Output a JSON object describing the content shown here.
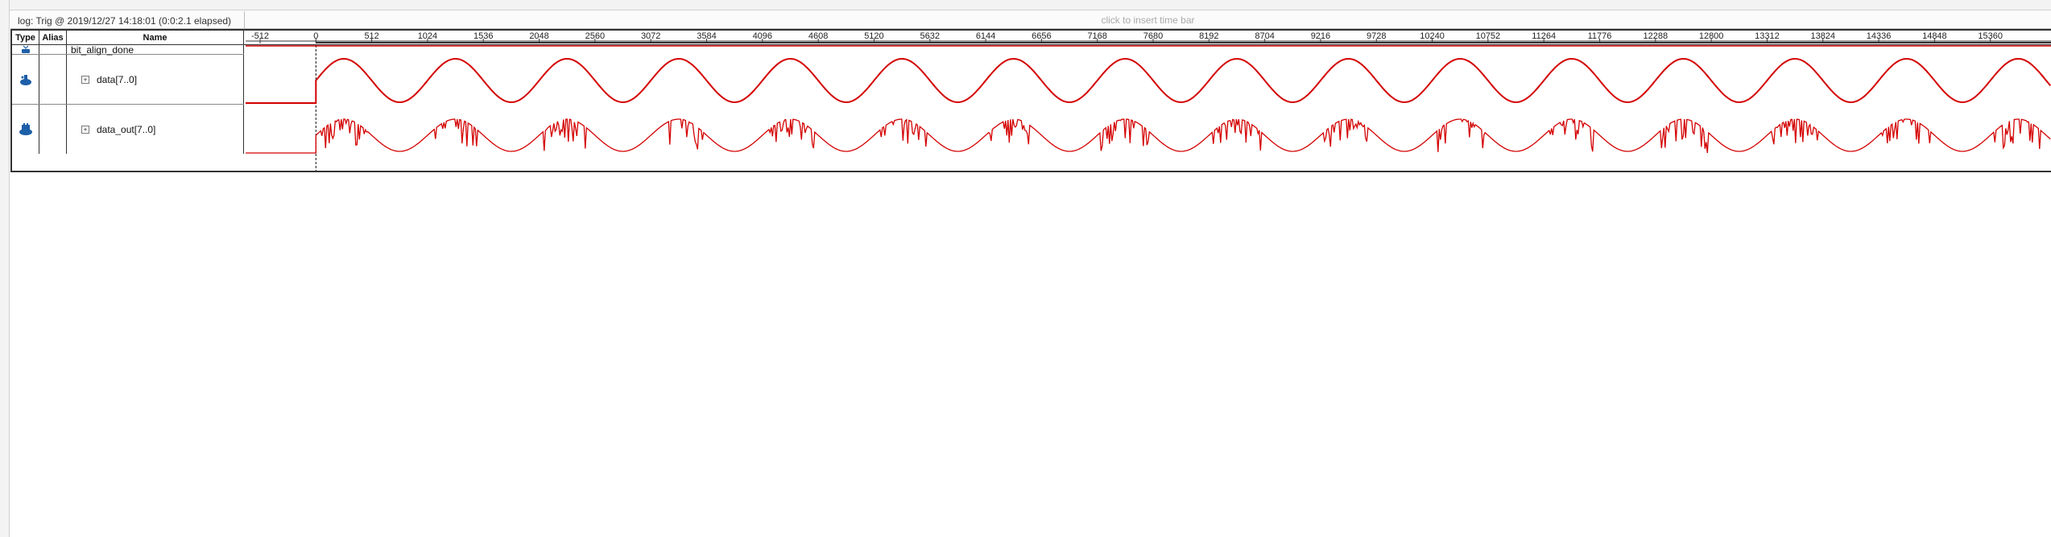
{
  "status": {
    "log_label": "log: Trig @ 2019/12/27 14:18:01 (0:0:2.1 elapsed)",
    "insert_time_bar": "click to insert time bar"
  },
  "columns": {
    "type": "Type",
    "alias": "Alias",
    "name": "Name"
  },
  "ruler": {
    "ticks": [
      "-512",
      "0",
      "512",
      "1024",
      "1536",
      "2048",
      "2560",
      "3072",
      "3584",
      "4096",
      "4608",
      "5120",
      "5632",
      "6144",
      "6656",
      "7168",
      "7680",
      "8192",
      "8704",
      "9216",
      "9728",
      "10240",
      "10752",
      "11264",
      "11776",
      "12288",
      "12800",
      "13312",
      "13824",
      "14336",
      "14848",
      "15360"
    ],
    "min": -512,
    "max": 15872,
    "trigger_at": 0
  },
  "signals": [
    {
      "name": "bit_align_done",
      "type_icon": "input-pin-icon",
      "expandable": false
    },
    {
      "name": "data[7..0]",
      "type_icon": "bus-icon",
      "expandable": true,
      "expander": "+"
    },
    {
      "name": "data_out[7..0]",
      "type_icon": "bus-output-icon",
      "expandable": true,
      "expander": "+"
    }
  ],
  "waveform": {
    "color": "#d40000",
    "data_period_samples": 1024,
    "data_out_period_samples": 1024,
    "bit_align_done_high_after": 0
  },
  "colors": {
    "wave": "#d40000",
    "grid_border": "#333333",
    "header_bg": "#fbfbfb"
  }
}
